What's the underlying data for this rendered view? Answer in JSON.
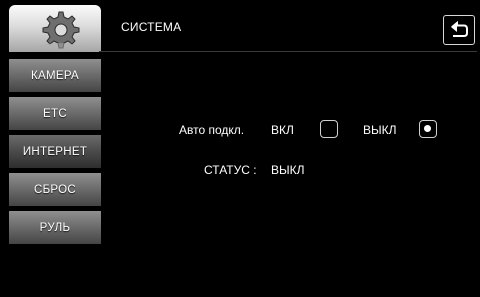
{
  "header": {
    "title": "СИСТЕМА"
  },
  "sidebar": {
    "items": [
      {
        "label": "КАМЕРА"
      },
      {
        "label": "ETC"
      },
      {
        "label": "ИНТЕРНЕТ"
      },
      {
        "label": "СБРОС"
      },
      {
        "label": "РУЛЬ"
      }
    ]
  },
  "main": {
    "auto_connect": {
      "label": "Авто подкл.",
      "on_label": "ВКЛ",
      "off_label": "ВЫКЛ",
      "on_checked": false,
      "off_checked": true
    },
    "status": {
      "label": "СТАТУС :",
      "value": "ВЫКЛ"
    }
  },
  "icons": {
    "logo": "gear-icon",
    "back": "back-arrow-icon"
  }
}
